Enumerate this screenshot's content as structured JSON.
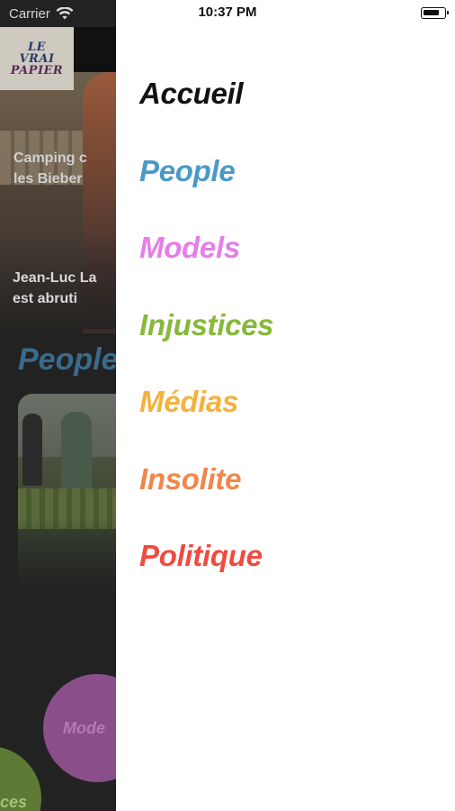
{
  "status_bar": {
    "carrier": "Carrier",
    "time": "10:37 PM",
    "battery_icon": "battery-icon",
    "wifi_icon": "wifi-icon"
  },
  "background": {
    "logo": {
      "line1": "LE",
      "line2": "VRAI",
      "line3": "PAPIER"
    },
    "hero_title": "Jean-Luc La\nest abruti",
    "section_title": "People",
    "card_title": "Camping c\nles Bieber",
    "circle_models": "Mode",
    "circle_injustices": "ces"
  },
  "drawer": {
    "menu": [
      {
        "label": "Accueil",
        "color": "#111111"
      },
      {
        "label": "People",
        "color": "#4a9ac8"
      },
      {
        "label": "Models",
        "color": "#e57ee8"
      },
      {
        "label": "Injustices",
        "color": "#86b83a"
      },
      {
        "label": "Médias",
        "color": "#f3b23e"
      },
      {
        "label": "Insolite",
        "color": "#f2864a"
      },
      {
        "label": "Politique",
        "color": "#ef4b3f"
      }
    ]
  }
}
